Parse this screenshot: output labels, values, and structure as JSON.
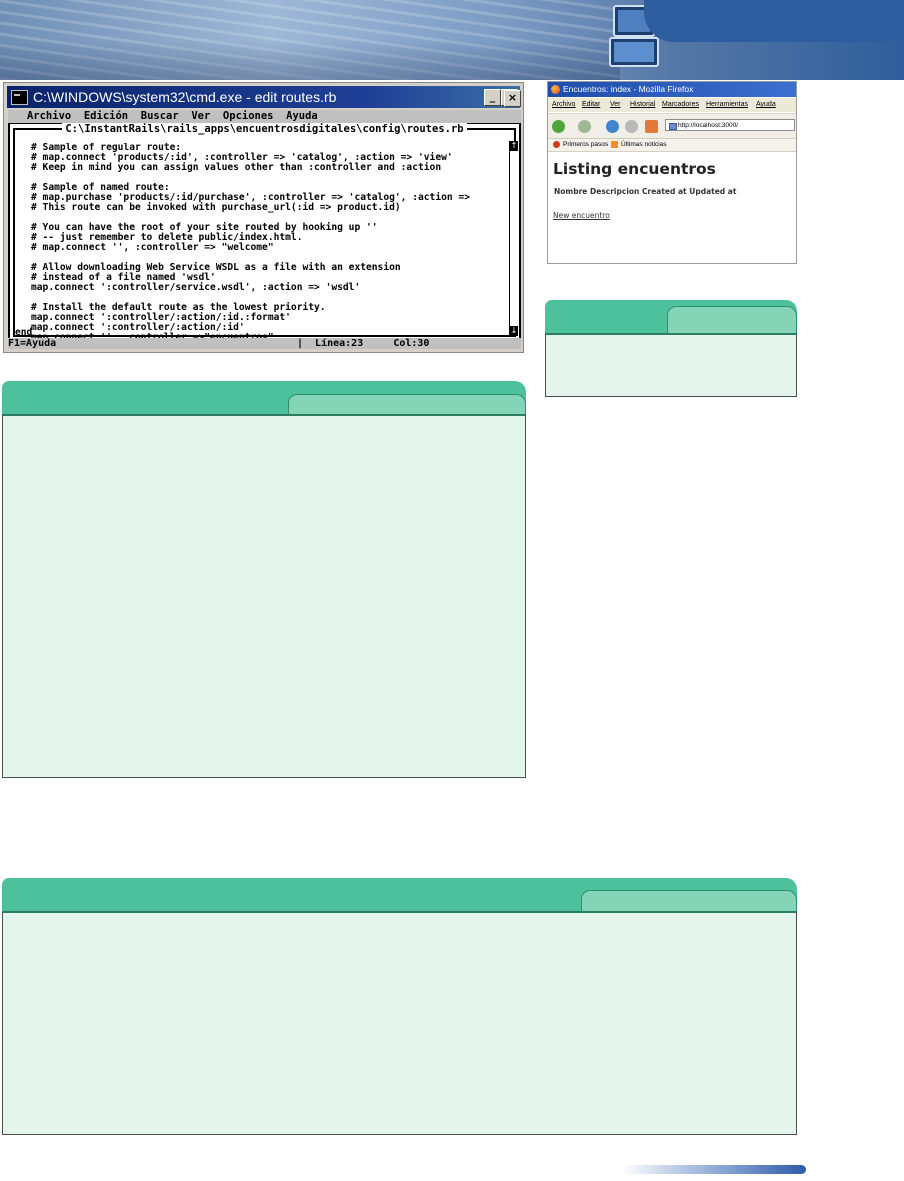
{
  "cmd": {
    "title": "C:\\WINDOWS\\system32\\cmd.exe - edit routes.rb",
    "menu": "   Archivo  Edición  Buscar  Ver  Opciones  Ayuda",
    "path": "C:\\InstantRails\\rails_apps\\encuentrosdigitales\\config\\routes.rb",
    "lines": [
      "# Sample of regular route:",
      "# map.connect 'products/:id', :controller => 'catalog', :action => 'view'",
      "# Keep in mind you can assign values other than :controller and :action",
      "",
      "# Sample of named route:",
      "# map.purchase 'products/:id/purchase', :controller => 'catalog', :action =>",
      "# This route can be invoked with purchase_url(:id => product.id)",
      "",
      "# You can have the root of your site routed by hooking up ''",
      "# -- just remember to delete public/index.html.",
      "# map.connect '', :controller => \"welcome\"",
      "",
      "# Allow downloading Web Service WSDL as a file with an extension",
      "# instead of a file named 'wsdl'",
      "map.connect ':controller/service.wsdl', :action => 'wsdl'",
      "",
      "# Install the default route as the lowest priority.",
      "map.connect ':controller/:action/:id.:format'",
      "map.connect ':controller/:action/:id'",
      "map.connect '', :controller =>\"encuentros\""
    ],
    "end_line": "end",
    "status": "F1=Ayuda                                        |  Línea:23     Col:30"
  },
  "firefox": {
    "title": "Encuentros: index - Mozilla Firefox",
    "menu": [
      "Archivo",
      "Editar",
      "Ver",
      "Historial",
      "Marcadores",
      "Herramientas",
      "Ayuda"
    ],
    "url": "http://localhost:3000/",
    "bookmarks": [
      "Primeros pasos",
      "Últimas noticias"
    ],
    "heading": "Listing encuentros",
    "table_headers": "Nombre Descripcion Created at Updated at",
    "link": "New encuentro"
  },
  "colors": {
    "box_header": "#4dc19c",
    "box_tab": "#84d4b7",
    "box_body": "#e4f5ed",
    "banner": "#2d5d9e"
  }
}
